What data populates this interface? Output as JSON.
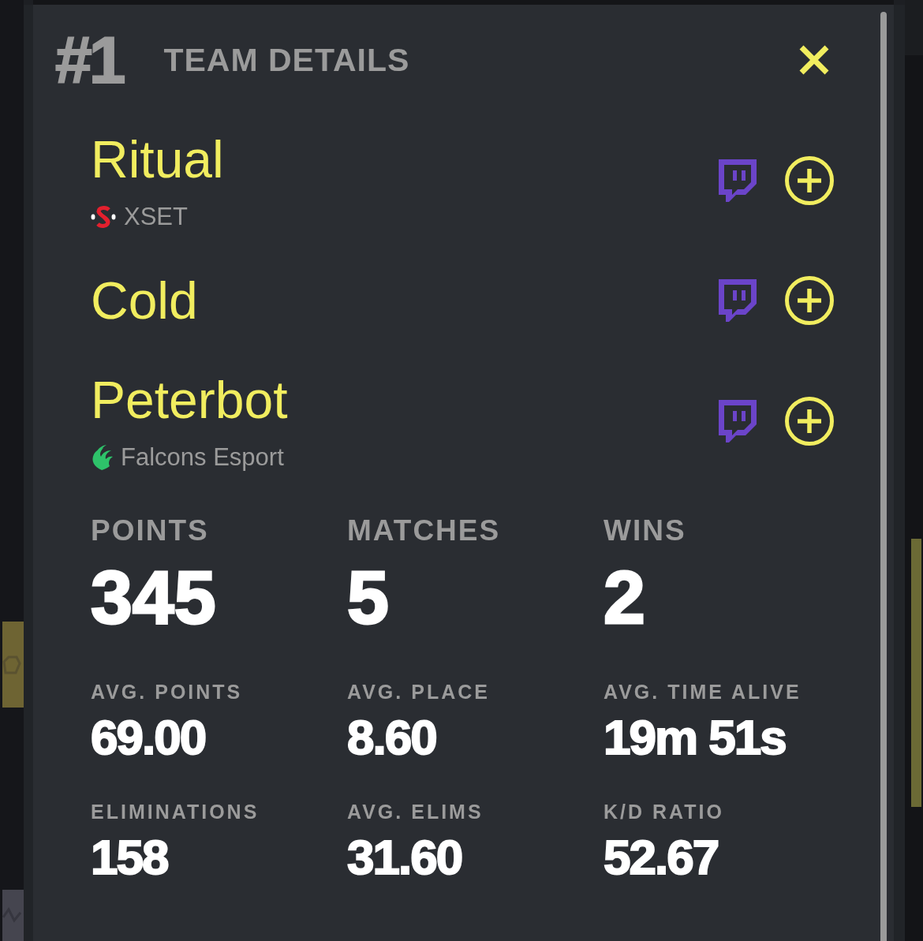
{
  "header": {
    "rank": "#1",
    "title": "TEAM DETAILS"
  },
  "players": [
    {
      "name": "Ritual",
      "org": {
        "name": "XSET",
        "kind": "xset"
      }
    },
    {
      "name": "Cold"
    },
    {
      "name": "Peterbot",
      "org": {
        "name": "Falcons Esport",
        "kind": "falcons"
      }
    }
  ],
  "stats": [
    {
      "kind": "primary",
      "label": "POINTS",
      "value": "345"
    },
    {
      "kind": "primary",
      "label": "MATCHES",
      "value": "5"
    },
    {
      "kind": "primary",
      "label": "WINS",
      "value": "2"
    },
    {
      "kind": "secondary",
      "label": "AVG. POINTS",
      "value": "69.00"
    },
    {
      "kind": "secondary",
      "label": "AVG. PLACE",
      "value": "8.60"
    },
    {
      "kind": "secondary",
      "label": "AVG. TIME ALIVE",
      "value": "19m 51s"
    },
    {
      "kind": "secondary",
      "label": "ELIMINATIONS",
      "value": "158"
    },
    {
      "kind": "secondary",
      "label": "AVG. ELIMS",
      "value": "31.60"
    },
    {
      "kind": "secondary",
      "label": "K/D RATIO",
      "value": "52.67"
    }
  ]
}
